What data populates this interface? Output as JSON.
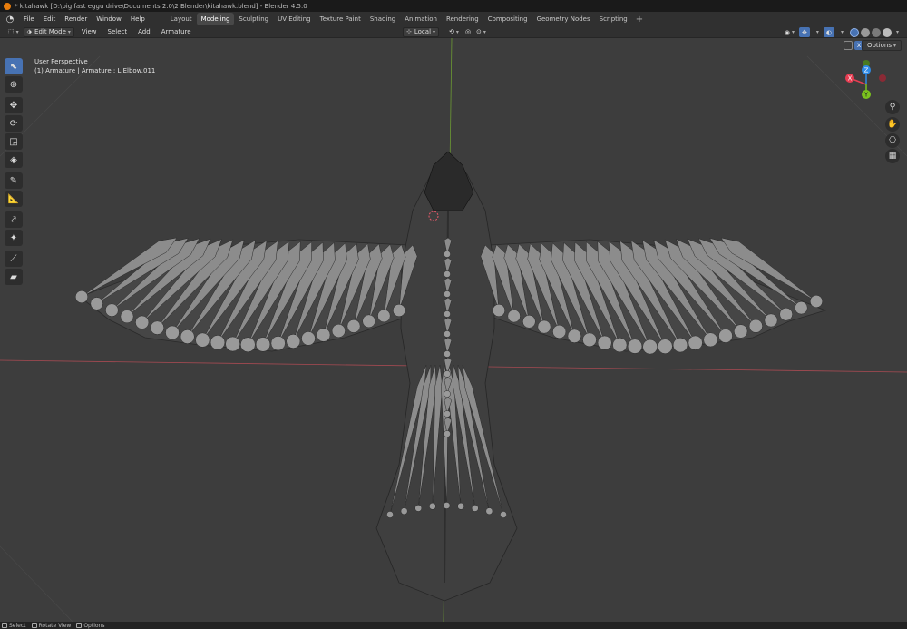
{
  "window": {
    "title": "* kitahawk [D:\\big fast eggu drive\\Documents 2.0\\2 Blender\\kitahawk.blend] - Blender 4.5.0"
  },
  "menubar": {
    "items": [
      "File",
      "Edit",
      "Render",
      "Window",
      "Help"
    ],
    "workspaces": [
      "Layout",
      "Modeling",
      "Sculpting",
      "UV Editing",
      "Texture Paint",
      "Shading",
      "Animation",
      "Rendering",
      "Compositing",
      "Geometry Nodes",
      "Scripting"
    ],
    "active_workspace": "Modeling",
    "add_label": "+"
  },
  "header": {
    "mode": "Edit Mode",
    "menus": [
      "View",
      "Select",
      "Add",
      "Armature"
    ],
    "orientation": "Local",
    "options_label": "Options",
    "xray_label": "X"
  },
  "viewport": {
    "perspective": "User Perspective",
    "selection": "(1) Armature | Armature : L.Elbow.011"
  },
  "gizmo": {
    "axes": [
      "X",
      "Y",
      "Z"
    ],
    "colors": {
      "x": "#e63d52",
      "y": "#7ac21e",
      "z": "#2e8ae6"
    }
  },
  "statusbar": {
    "items": [
      "Select",
      "Rotate View",
      "Options"
    ]
  },
  "colors": {
    "accent": "#4772b3",
    "viewport_bg": "#3d3d3d",
    "header_bg": "#303030"
  }
}
